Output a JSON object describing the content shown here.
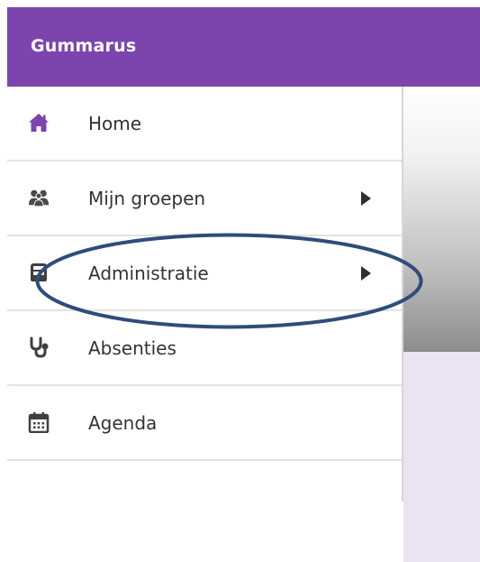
{
  "app": {
    "title": "Gummarus"
  },
  "colors": {
    "header": "#7b45ad",
    "menu_icon": "#7b45ad",
    "annotation_ellipse": "#2e4d7a"
  },
  "sidebar": {
    "items": [
      {
        "label": "Home",
        "icon": "home-icon",
        "has_submenu": false
      },
      {
        "label": "Mijn groepen",
        "icon": "group-icon",
        "has_submenu": true
      },
      {
        "label": "Administratie",
        "icon": "archive-icon",
        "has_submenu": true
      },
      {
        "label": "Absenties",
        "icon": "stethoscope-icon",
        "has_submenu": false
      },
      {
        "label": "Agenda",
        "icon": "calendar-icon",
        "has_submenu": false
      }
    ]
  }
}
